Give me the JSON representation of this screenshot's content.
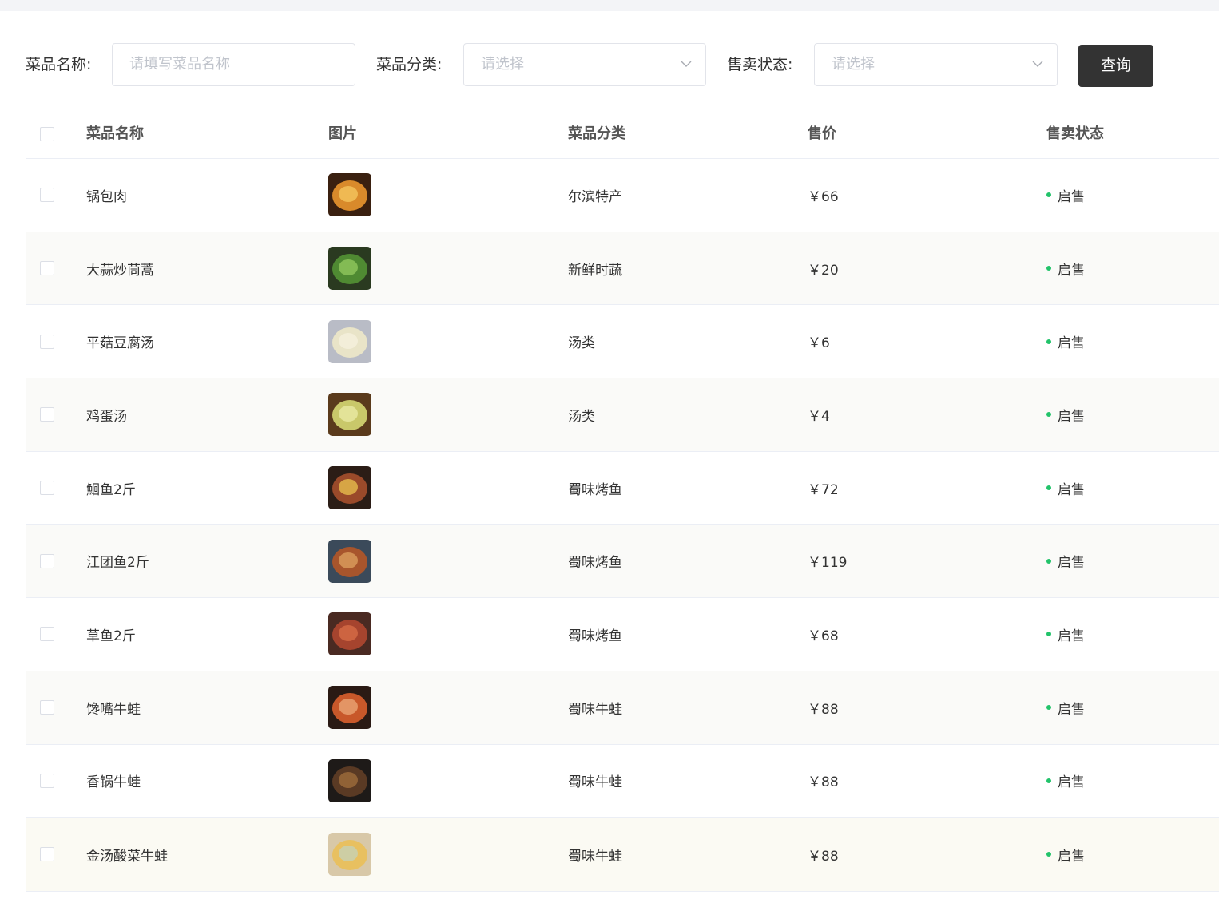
{
  "filters": {
    "name_label": "菜品名称:",
    "name_placeholder": "请填写菜品名称",
    "category_label": "菜品分类:",
    "category_placeholder": "请选择",
    "status_label": "售卖状态:",
    "status_placeholder": "请选择",
    "query_button": "查询"
  },
  "table": {
    "headers": {
      "name": "菜品名称",
      "image": "图片",
      "category": "菜品分类",
      "price": "售价",
      "status": "售卖状态"
    },
    "rows": [
      {
        "name": "锅包肉",
        "category": "尔滨特产",
        "price": "￥66",
        "status": "启售",
        "image_icon": "dish-photo-icon"
      },
      {
        "name": "大蒜炒茼蒿",
        "category": "新鲜时蔬",
        "price": "￥20",
        "status": "启售",
        "image_icon": "dish-photo-icon"
      },
      {
        "name": "平菇豆腐汤",
        "category": "汤类",
        "price": "￥6",
        "status": "启售",
        "image_icon": "dish-photo-icon"
      },
      {
        "name": "鸡蛋汤",
        "category": "汤类",
        "price": "￥4",
        "status": "启售",
        "image_icon": "dish-photo-icon"
      },
      {
        "name": "鮰鱼2斤",
        "category": "蜀味烤鱼",
        "price": "￥72",
        "status": "启售",
        "image_icon": "dish-photo-icon"
      },
      {
        "name": "江团鱼2斤",
        "category": "蜀味烤鱼",
        "price": "￥119",
        "status": "启售",
        "image_icon": "dish-photo-icon"
      },
      {
        "name": "草鱼2斤",
        "category": "蜀味烤鱼",
        "price": "￥68",
        "status": "启售",
        "image_icon": "dish-photo-icon"
      },
      {
        "name": "馋嘴牛蛙",
        "category": "蜀味牛蛙",
        "price": "￥88",
        "status": "启售",
        "image_icon": "dish-photo-icon"
      },
      {
        "name": "香锅牛蛙",
        "category": "蜀味牛蛙",
        "price": "￥88",
        "status": "启售",
        "image_icon": "dish-photo-icon"
      },
      {
        "name": "金汤酸菜牛蛙",
        "category": "蜀味牛蛙",
        "price": "￥88",
        "status": "启售",
        "image_icon": "dish-photo-icon"
      }
    ]
  },
  "colors": {
    "status_on": "#22c36a",
    "button_dark": "#333333"
  }
}
